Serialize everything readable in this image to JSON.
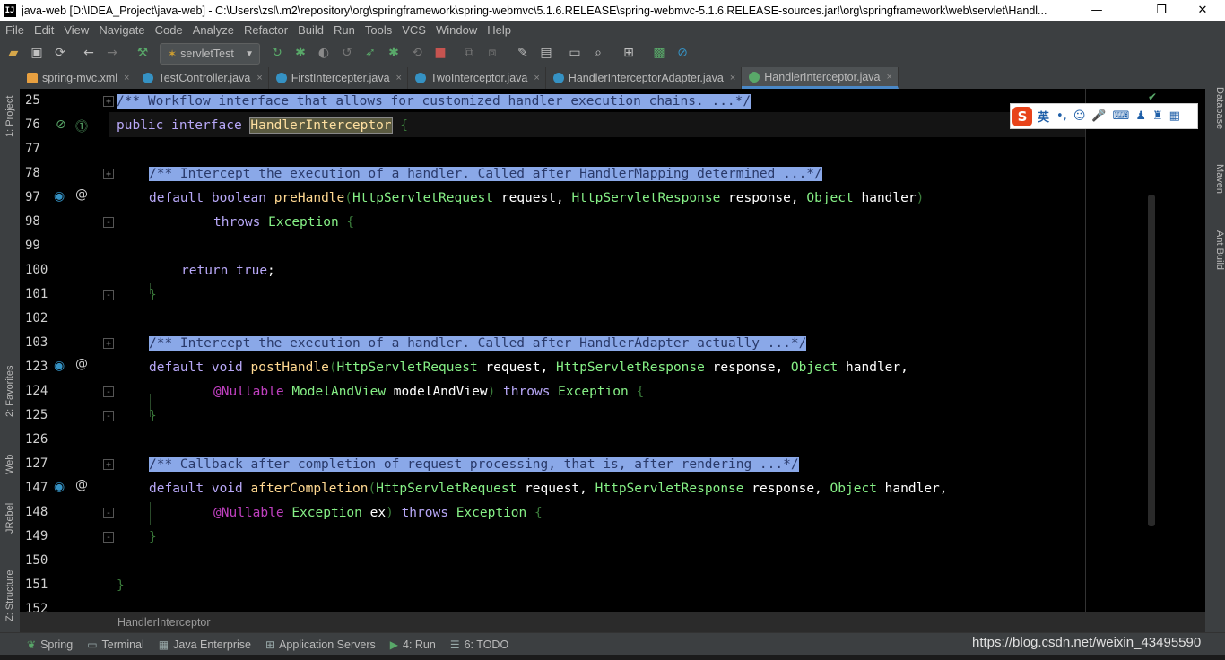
{
  "window": {
    "title": "java-web [D:\\IDEA_Project\\java-web] - C:\\Users\\zsl\\.m2\\repository\\org\\springframework\\spring-webmvc\\5.1.6.RELEASE\\spring-webmvc-5.1.6.RELEASE-sources.jar!\\org\\springframework\\web\\servlet\\Handl...",
    "app_icon_text": "IJ"
  },
  "menu": [
    "File",
    "Edit",
    "View",
    "Navigate",
    "Code",
    "Analyze",
    "Refactor",
    "Build",
    "Run",
    "Tools",
    "VCS",
    "Window",
    "Help"
  ],
  "toolbar": {
    "run_config": "servletTest"
  },
  "tabs": [
    {
      "label": "spring-mvc.xml",
      "color": "#e8a040"
    },
    {
      "label": "TestController.java",
      "color": "#3592c4"
    },
    {
      "label": "FirstIntercepter.java",
      "color": "#3592c4"
    },
    {
      "label": "TwoInterceptor.java",
      "color": "#3592c4"
    },
    {
      "label": "HandlerInterceptorAdapter.java",
      "color": "#3592c4"
    },
    {
      "label": "HandlerInterceptor.java",
      "color": "#59a869",
      "active": true
    }
  ],
  "left_tools": [
    "1: Project",
    "2: Favorites",
    "Web",
    "JRebel",
    "Z: Structure"
  ],
  "right_tools": [
    "Database",
    "Maven",
    "Ant Build"
  ],
  "lines": [
    {
      "no": "25"
    },
    {
      "no": "76"
    },
    {
      "no": "77"
    },
    {
      "no": "78"
    },
    {
      "no": "97"
    },
    {
      "no": "98"
    },
    {
      "no": "99"
    },
    {
      "no": "100"
    },
    {
      "no": "101"
    },
    {
      "no": "102"
    },
    {
      "no": "103"
    },
    {
      "no": "123"
    },
    {
      "no": "124"
    },
    {
      "no": "125"
    },
    {
      "no": "126"
    },
    {
      "no": "127"
    },
    {
      "no": "147"
    },
    {
      "no": "148"
    },
    {
      "no": "149"
    },
    {
      "no": "150"
    },
    {
      "no": "151"
    },
    {
      "no": "152"
    }
  ],
  "code": {
    "l25": "/** Workflow interface that allows for customized handler execution chains. ...*/",
    "l76_kw": "public interface ",
    "l76_name": "HandlerInterceptor",
    "l78": "/** Intercept the execution of a handler. Called after HandlerMapping determined ...*/",
    "l103": "/** Intercept the execution of a handler. Called after HandlerAdapter actually ...*/",
    "l127": "/** Callback after completion of request processing, that is, after rendering ...*/",
    "kw_default": "default",
    "kw_boolean": "boolean",
    "kw_void": "void",
    "kw_throws": "throws",
    "kw_return": "return",
    "kw_true": "true",
    "fn_pre": "preHandle",
    "fn_post": "postHandle",
    "fn_after": "afterCompletion",
    "ty_req": "HttpServletRequest",
    "ty_resp": "HttpServletResponse",
    "ty_obj": "Object",
    "ty_exc": "Exception",
    "ty_mav": "ModelAndView",
    "an_nullable": "@Nullable",
    "p_request": " request, ",
    "p_response": " response, ",
    "p_handler": " handler",
    "p_handler_c": " handler,",
    "p_mav": " modelAndView",
    "p_ex": " ex"
  },
  "ime": {
    "mode": "英"
  },
  "breadcrumb": "HandlerInterceptor",
  "status": [
    "Spring",
    "Terminal",
    "Java Enterprise",
    "Application Servers",
    "4: Run",
    "6: TODO"
  ],
  "watermark": "https://blog.csdn.net/weixin_43495590"
}
